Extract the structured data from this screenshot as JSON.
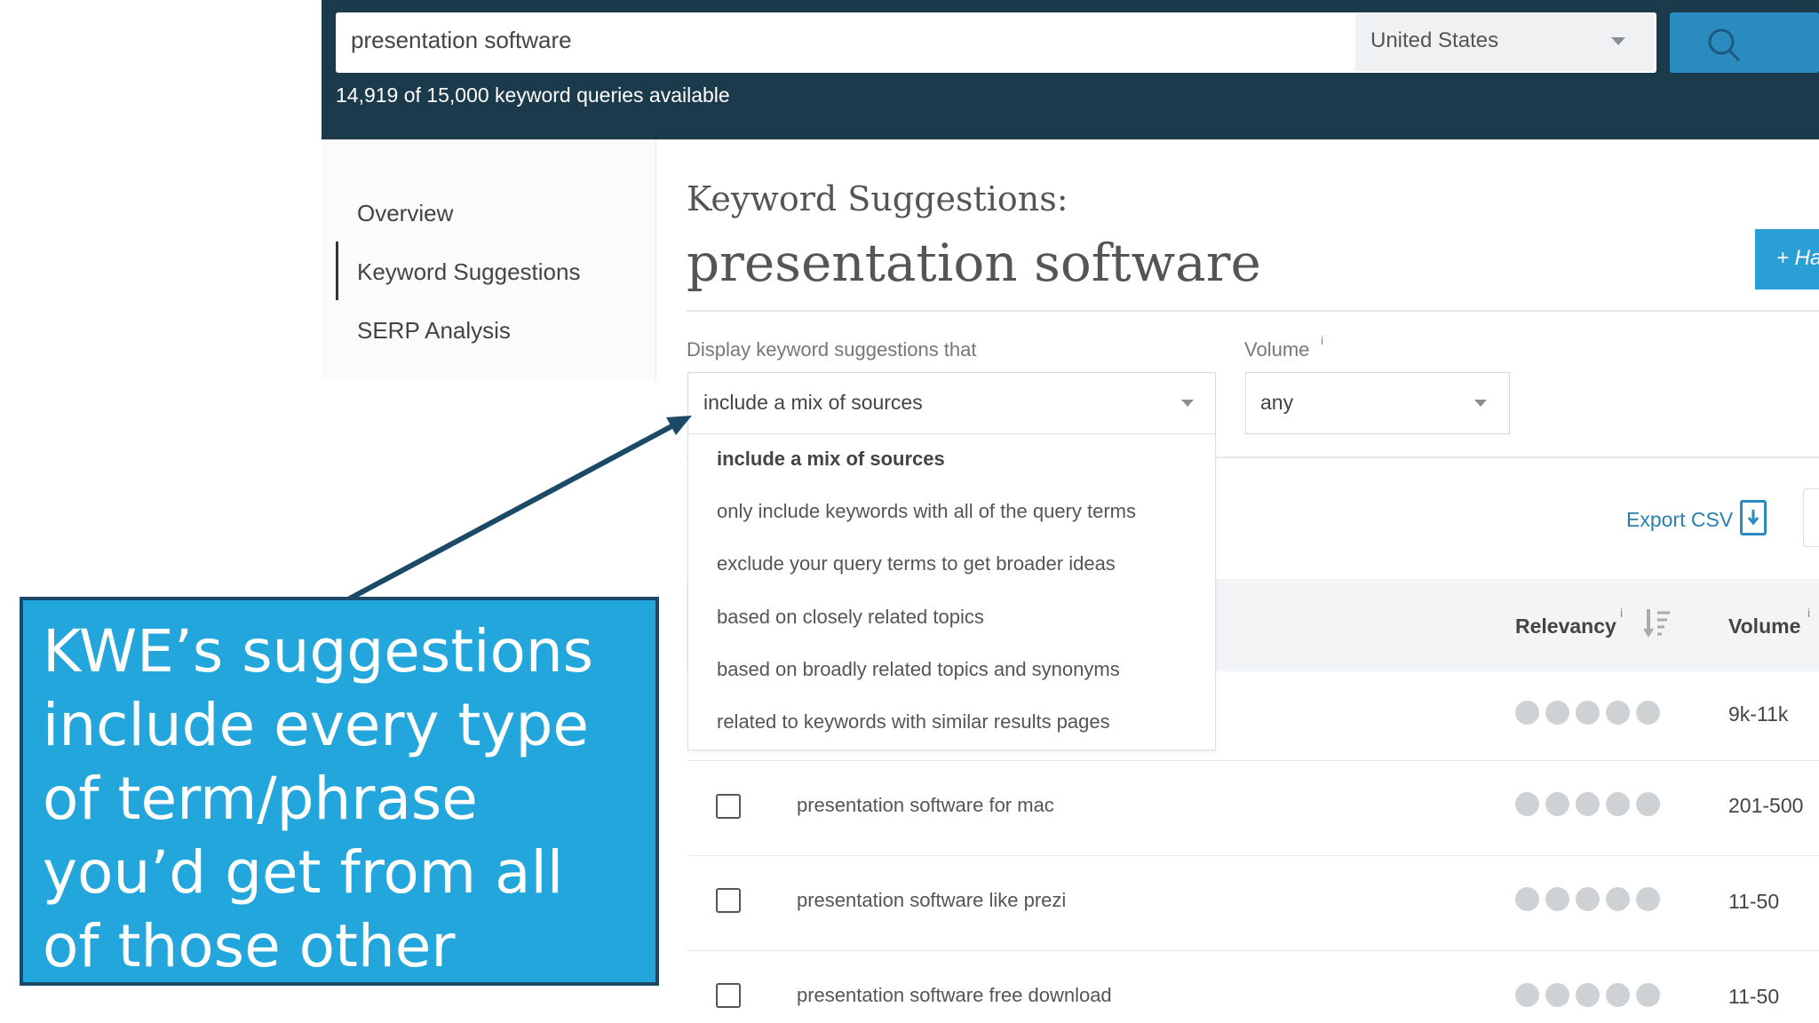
{
  "search": {
    "query": "presentation software",
    "country": "United States",
    "queries_available": "14,919 of 15,000 keyword queries available"
  },
  "sidebar": {
    "items": [
      {
        "label": "Overview"
      },
      {
        "label": "Keyword Suggestions",
        "active": true
      },
      {
        "label": "SERP Analysis"
      }
    ]
  },
  "main": {
    "subtitle": "Keyword Suggestions:",
    "title": "presentation software",
    "add_button_label": "+ Ha",
    "filter_label": "Display keyword suggestions that",
    "filter_value": "include a mix of sources",
    "volume_label": "Volume",
    "volume_info": "i",
    "volume_value": "any",
    "dropdown_options": [
      {
        "label": "include a mix of sources",
        "selected": true
      },
      {
        "label": "only include keywords with all of the query terms"
      },
      {
        "label": "exclude your query terms to get broader ideas"
      },
      {
        "label": "based on closely related topics"
      },
      {
        "label": "based on broadly related topics and synonyms"
      },
      {
        "label": "related to keywords with similar results pages"
      }
    ],
    "export_label": "Export CSV",
    "columns": {
      "relevancy": "Relevancy",
      "relevancy_info": "i",
      "volume": "Volume",
      "volume_info": "i"
    },
    "rows": [
      {
        "keyword": "",
        "volume": "9k-11k"
      },
      {
        "keyword": "presentation software for mac",
        "volume": "201-500"
      },
      {
        "keyword": "presentation software like prezi",
        "volume": "11-50"
      },
      {
        "keyword": "presentation software free download",
        "volume": "11-50"
      }
    ]
  },
  "callout": {
    "text": "KWE’s suggestions\ninclude every type\nof term/phrase\nyou’d get from all\nof those other"
  },
  "colors": {
    "topbar": "#1b3a4c",
    "accent": "#2a9fd6",
    "callout_bg": "#23a6dc",
    "callout_border": "#1b4a68"
  }
}
